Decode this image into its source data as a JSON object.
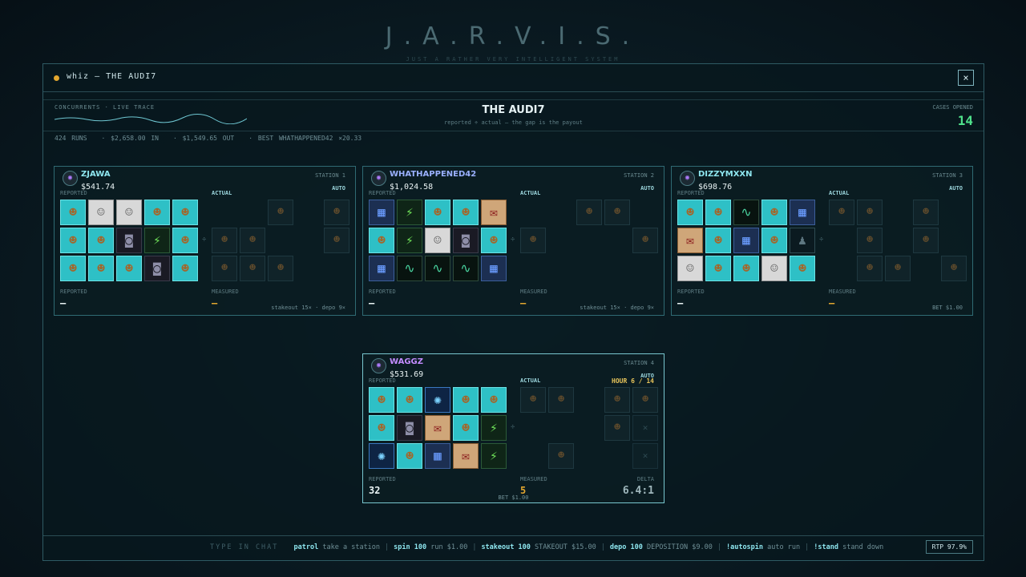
{
  "background": {
    "title": "J.A.R.V.I.S.",
    "subtitle": "JUST A RATHER VERY INTELLIGENT SYSTEM"
  },
  "window": {
    "title": "whiz — THE AUDI7",
    "close_label": "×"
  },
  "header": {
    "concurrents_label": "CONCURRENTS · LIVE TRACE",
    "title": "THE AUDI7",
    "subtitle": "reported ÷ actual — the gap is the payout",
    "cases_label": "CASES OPENED",
    "cases_value": "14"
  },
  "stats": {
    "runs": "424 RUNS",
    "in": "$2,658.00 IN",
    "out": "$1,549.65 OUT",
    "best": "BEST WHATHAPPENED42 ×20.33"
  },
  "stations": [
    {
      "player": "ZJAWA",
      "name_color": "#8ee6ef",
      "balance": "$541.74",
      "station": "STATION 1",
      "mode": "AUTO",
      "reported_label": "REPORTED",
      "actual_label": "ACTUAL",
      "reported_grid": [
        "bust",
        "paper",
        "paper",
        "bust",
        "bust",
        "bust",
        "bust",
        "tape",
        "bolt",
        "bust",
        "bust",
        "bust",
        "bust",
        "tape",
        "bust"
      ],
      "actual_grid": [
        "",
        "",
        "dim",
        "",
        "dim",
        "dim",
        "dim",
        "",
        "",
        "dim",
        "dim",
        "dim",
        "dim",
        "",
        ""
      ],
      "bottom_reported_label": "REPORTED",
      "bottom_reported_value": "—",
      "bottom_measured_label": "MEASURED",
      "bottom_measured_value": "—",
      "footer": "stakeout 15×  ·  depo 9×"
    },
    {
      "player": "WHATHAPPENED42",
      "name_color": "#9ab0ff",
      "balance": "$1,024.58",
      "station": "STATION 2",
      "mode": "AUTO",
      "reported_label": "REPORTED",
      "actual_label": "ACTUAL",
      "reported_grid": [
        "server",
        "bolt",
        "bust",
        "bust",
        "scroll",
        "bust",
        "bolt",
        "paper",
        "tape",
        "bust",
        "server",
        "wave",
        "wave",
        "wave",
        "server"
      ],
      "actual_grid": [
        "",
        "",
        "dim",
        "dim",
        "",
        "dim",
        "",
        "",
        "",
        "dim",
        "",
        "",
        "",
        "",
        ""
      ],
      "bottom_reported_label": "REPORTED",
      "bottom_reported_value": "—",
      "bottom_measured_label": "MEASURED",
      "bottom_measured_value": "—",
      "footer": "stakeout 15×  ·  depo 9×"
    },
    {
      "player": "DIZZYMXXN",
      "name_color": "#8ee6ef",
      "balance": "$698.76",
      "station": "STATION 3",
      "mode": "AUTO",
      "reported_label": "REPORTED",
      "actual_label": "ACTUAL",
      "reported_grid": [
        "bust",
        "bust",
        "wave",
        "bust",
        "server",
        "scroll",
        "bust",
        "server",
        "bust",
        "hood",
        "paper",
        "bust",
        "bust",
        "paper",
        "bust"
      ],
      "actual_grid": [
        "dim",
        "dim",
        "",
        "dim",
        "",
        "",
        "dim",
        "",
        "dim",
        "",
        "",
        "dim",
        "dim",
        "",
        "dim"
      ],
      "bottom_reported_label": "REPORTED",
      "bottom_reported_value": "—",
      "bottom_measured_label": "MEASURED",
      "bottom_measured_value": "—",
      "footer": "BET $1.00"
    },
    {
      "player": "WAGGZ",
      "name_color": "#c38cff",
      "balance": "$531.69",
      "station": "STATION 4",
      "mode": "AUTO",
      "hour": "HOUR 6 / 14",
      "reported_label": "REPORTED",
      "actual_label": "ACTUAL",
      "reported_grid": [
        "bust",
        "bust",
        "orb",
        "bust",
        "bust",
        "bust",
        "tape",
        "scroll",
        "bust",
        "bolt",
        "orb",
        "bust",
        "server",
        "scroll",
        "bolt"
      ],
      "actual_grid": [
        "dim",
        "dim",
        "",
        "dim",
        "dim",
        "",
        "",
        "",
        "dim",
        "empty",
        "",
        "dim",
        "",
        "",
        "empty"
      ],
      "bottom_reported_label": "REPORTED",
      "bottom_reported_value": "32",
      "bottom_measured_label": "MEASURED",
      "bottom_measured_value": "5",
      "bottom_delta_label": "DELTA",
      "bottom_delta_value": "6.4:1",
      "footer": "BET $1.00"
    }
  ],
  "chat": {
    "lead": "TYPE IN CHAT",
    "commands": [
      {
        "cmd": "patrol",
        "desc": "take a station"
      },
      {
        "cmd": "spin 100",
        "desc": "run $1.00"
      },
      {
        "cmd": "stakeout 100",
        "desc": "STAKEOUT $15.00"
      },
      {
        "cmd": "depo 100",
        "desc": "DEPOSITION $9.00"
      },
      {
        "cmd": "!autospin",
        "desc": "auto run"
      },
      {
        "cmd": "!stand",
        "desc": "stand down"
      }
    ],
    "rtp": "RTP 97.9%"
  },
  "icons": {
    "bust": "bust-icon",
    "paper": "paper-profile-icon",
    "server": "server-rack-icon",
    "bolt": "lightning-bolt-icon",
    "tape": "tape-reel-icon",
    "wave": "waveform-monitor-icon",
    "scroll": "evidence-scroll-icon",
    "orb": "orbit-atom-icon",
    "hood": "hooded-figure-icon"
  },
  "colors": {
    "accent": "#8ee6ef",
    "cases": "#4fe08b",
    "measured": "#e3a72f"
  }
}
